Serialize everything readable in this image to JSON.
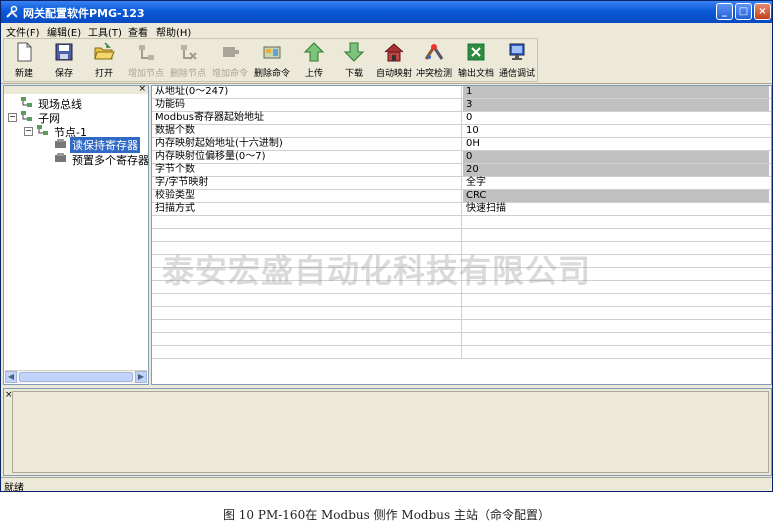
{
  "window": {
    "title": "网关配置软件PMG-123",
    "minimize": "_",
    "maximize": "□",
    "close": "×"
  },
  "menu": [
    "文件(F)",
    "编辑(E)",
    "工具(T)",
    "查看",
    "帮助(H)"
  ],
  "toolbar": [
    {
      "label": "新建",
      "icon": "new-file-icon",
      "enabled": true
    },
    {
      "label": "保存",
      "icon": "save-icon",
      "enabled": true
    },
    {
      "label": "打开",
      "icon": "open-folder-icon",
      "enabled": true
    },
    {
      "label": "增加节点",
      "icon": "add-node-icon",
      "enabled": false
    },
    {
      "label": "删除节点",
      "icon": "delete-node-icon",
      "enabled": false
    },
    {
      "label": "增加命令",
      "icon": "add-command-icon",
      "enabled": false
    },
    {
      "label": "删除命令",
      "icon": "delete-command-icon",
      "enabled": true
    },
    {
      "label": "上传",
      "icon": "upload-arrow-icon",
      "enabled": true
    },
    {
      "label": "下载",
      "icon": "download-arrow-icon",
      "enabled": true
    },
    {
      "label": "自动映射",
      "icon": "auto-map-house-icon",
      "enabled": true
    },
    {
      "label": "冲突检测",
      "icon": "conflict-check-icon",
      "enabled": true
    },
    {
      "label": "输出文档",
      "icon": "export-document-icon",
      "enabled": true
    },
    {
      "label": "通信调试",
      "icon": "comm-debug-monitor-icon",
      "enabled": true
    }
  ],
  "tree": {
    "root": "现场总线",
    "subnet": "子网",
    "node": "节点-1",
    "items": [
      "读保持寄存器",
      "预置多个寄存器"
    ],
    "selected_index": 0
  },
  "properties": [
    {
      "name": "从地址(0～247)",
      "value": "1",
      "grey": true
    },
    {
      "name": "功能码",
      "value": "3",
      "grey": true
    },
    {
      "name": "Modbus寄存器起始地址",
      "value": "0",
      "grey": false
    },
    {
      "name": "数据个数",
      "value": "10",
      "grey": false
    },
    {
      "name": "内存映射起始地址(十六进制)",
      "value": "0H",
      "grey": false
    },
    {
      "name": "内存映射位偏移量(0～7)",
      "value": "0",
      "grey": true
    },
    {
      "name": "字节个数",
      "value": "20",
      "grey": true
    },
    {
      "name": "字/字节映射",
      "value": "全字",
      "grey": false
    },
    {
      "name": "校验类型",
      "value": "CRC",
      "grey": true
    },
    {
      "name": "扫描方式",
      "value": "快速扫描",
      "grey": false
    }
  ],
  "empty_rows": 11,
  "watermark": "泰安宏盛自动化科技有限公司",
  "status": "就绪",
  "caption": "图 10  PM-160在 Modbus 侧作 Modbus 主站（命令配置）",
  "colors": {
    "titlebar": "#0a5ad7",
    "selection": "#316ac5",
    "grey_cell": "#c0c0c0",
    "chrome": "#ece9d8"
  }
}
